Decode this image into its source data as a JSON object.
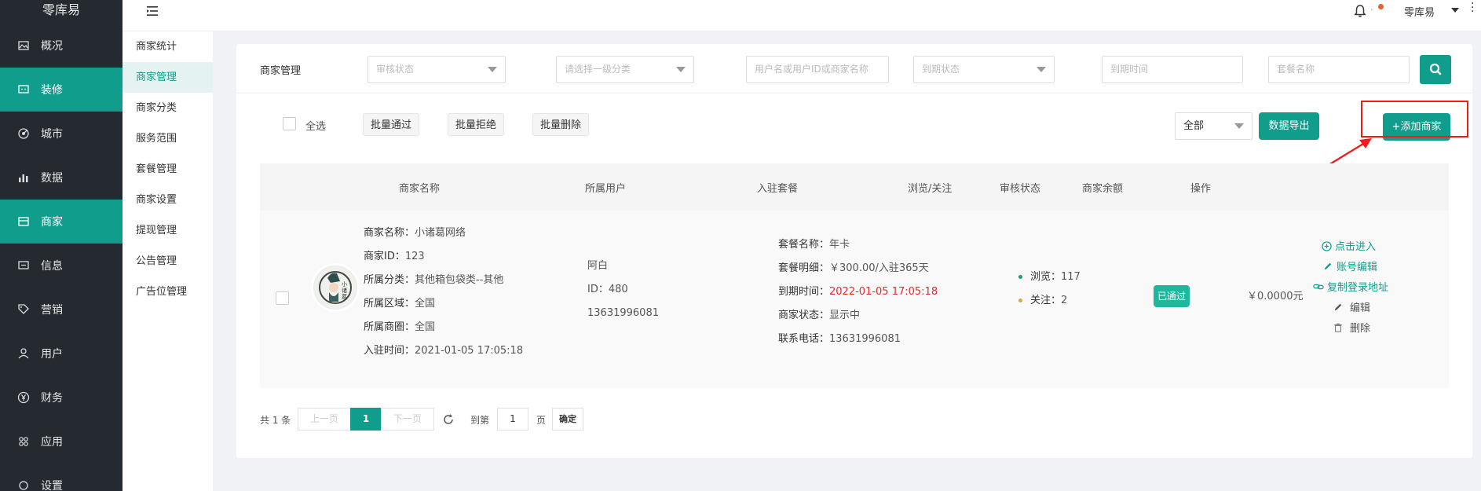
{
  "app": {
    "brand": "零库易"
  },
  "sidebar": {
    "items": [
      {
        "label": "概况",
        "icon": "image-icon"
      },
      {
        "label": "装修",
        "icon": "message-icon",
        "active": true
      },
      {
        "label": "城市",
        "icon": "radar-icon"
      },
      {
        "label": "数据",
        "icon": "bar-chart-icon"
      },
      {
        "label": "商家",
        "icon": "store-icon",
        "active": true
      },
      {
        "label": "信息",
        "icon": "chat-icon"
      },
      {
        "label": "营销",
        "icon": "tag-icon"
      },
      {
        "label": "用户",
        "icon": "user-icon"
      },
      {
        "label": "财务",
        "icon": "yen-icon"
      },
      {
        "label": "应用",
        "icon": "apps-icon"
      },
      {
        "label": "设置",
        "icon": "settings-icon"
      }
    ]
  },
  "subnav": {
    "items": [
      "商家统计",
      "商家管理",
      "商家分类",
      "服务范围",
      "套餐管理",
      "商家设置",
      "提现管理",
      "公告管理",
      "广告位管理"
    ],
    "active_index": 1
  },
  "header": {
    "user": "零库易",
    "bell_sep": "·"
  },
  "filters": {
    "title": "商家管理",
    "audit_status_placeholder": "审核状态",
    "category_placeholder": "请选择一级分类",
    "keyword_placeholder": "用户名或用户ID或商家名称",
    "expire_status_placeholder": "到期状态",
    "expire_time_placeholder": "到期时间",
    "package_name_placeholder": "套餐名称"
  },
  "actions": {
    "select_all": "全选",
    "batch_approve": "批量通过",
    "batch_reject": "批量拒绝",
    "batch_delete": "批量删除",
    "package_filter_value": "全部",
    "export": "数据导出",
    "add_merchant": "+添加商家"
  },
  "table": {
    "columns": [
      "商家名称",
      "所属用户",
      "入驻套餐",
      "浏览/关注",
      "审核状态",
      "商家余额",
      "操作"
    ],
    "rows": [
      {
        "merchant_lines": [
          {
            "k": "商家名称：",
            "v": "小诸葛网络"
          },
          {
            "k": "商家ID：",
            "v": "123"
          },
          {
            "k": "所属分类：",
            "v": "其他箱包袋类--其他"
          },
          {
            "k": "所属区域：",
            "v": "全国"
          },
          {
            "k": "所属商圈：",
            "v": "全国"
          },
          {
            "k": "入驻时间：",
            "v": "2021-01-05 17:05:18"
          }
        ],
        "user": {
          "name": "阿白",
          "id": "ID：480",
          "phone": "13631996081"
        },
        "package_lines": [
          {
            "k": "套餐名称：",
            "v": "年卡"
          },
          {
            "k": "套餐明细：",
            "v": "￥300.00/入驻365天"
          },
          {
            "k": "到期时间：",
            "v": "2022-01-05 17:05:18",
            "color": "#e8282c"
          },
          {
            "k": "商家状态：",
            "v": "显示中"
          },
          {
            "k": "联系电话：",
            "v": "13631996081"
          }
        ],
        "stats": [
          {
            "k": "浏览：",
            "v": "117",
            "color": "#119d8c"
          },
          {
            "k": "关注：",
            "v": "2",
            "color": "#e6a23c"
          }
        ],
        "audit": "已通过",
        "balance": "￥0.0000元",
        "ops": [
          "点击进入",
          "账号编辑",
          "复制登录地址",
          "编辑",
          "删除"
        ]
      }
    ]
  },
  "pagination": {
    "total": "共 1 条",
    "prev": "上一页",
    "current": "1",
    "next": "下一页",
    "goto": "到第",
    "page_value": "1",
    "page_unit": "页",
    "confirm": "确定"
  },
  "colors": {
    "accent": "#119d8c",
    "sidebar": "#252a30",
    "danger": "#e8282c",
    "highlight_box": "#ef1c1c"
  }
}
